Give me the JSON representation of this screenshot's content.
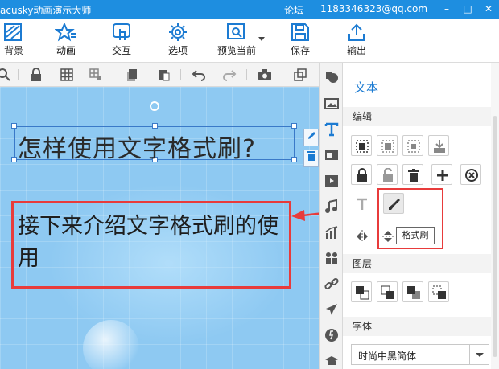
{
  "titlebar": {
    "app_title": "acusky动画演示大师",
    "forum": "论坛",
    "account": "1183346323@qq.com",
    "minimize": "–",
    "maximize": "□",
    "close": "✕"
  },
  "ribbon": {
    "background": "背景",
    "animation": "动画",
    "interaction": "交互",
    "options": "选项",
    "preview": "预览当前",
    "save": "保存",
    "export": "输出"
  },
  "canvas": {
    "heading_text": "怎样使用文字格式刷?",
    "body_text": "接下来介绍文字格式刷的使用"
  },
  "panel": {
    "title": "文本",
    "section_edit": "编辑",
    "tooltip": "格式刷",
    "section_layer": "图层",
    "section_font": "字体",
    "font_value": "时尚中黑简体"
  },
  "colors": {
    "titlebar": "#1e8ee0",
    "accent": "#1c7bd2",
    "canvas": "#8ec9f2",
    "highlight_red": "#e83b3b"
  }
}
